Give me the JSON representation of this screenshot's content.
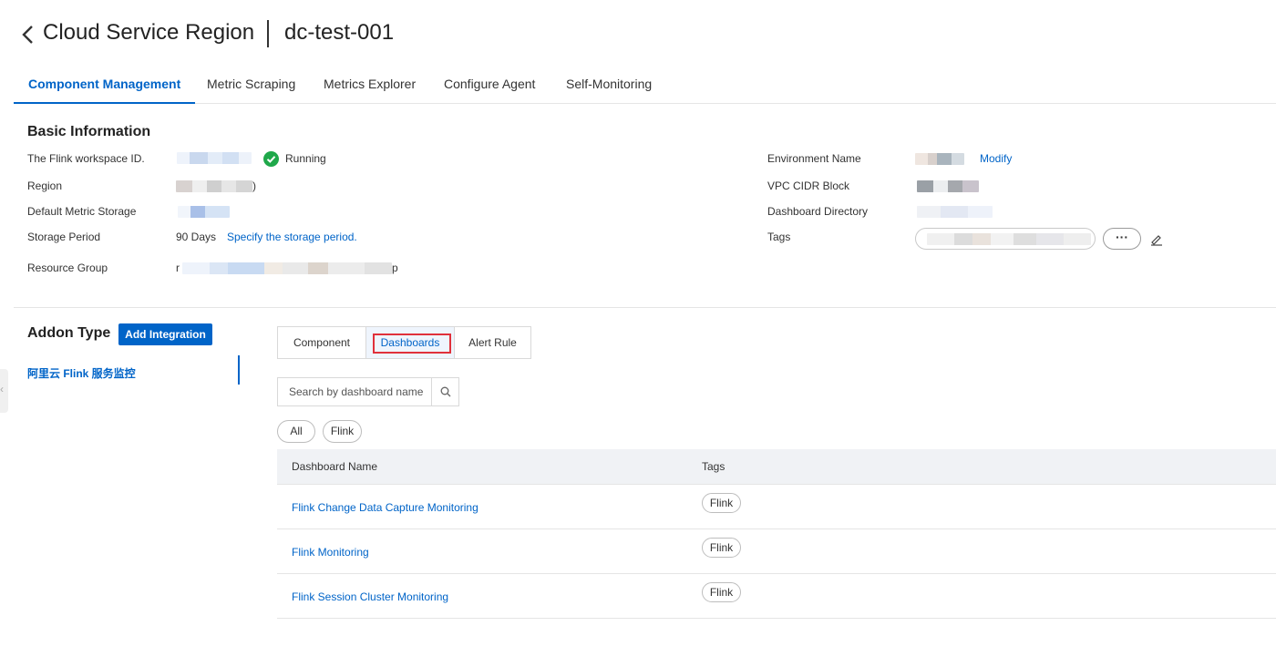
{
  "header": {
    "back_icon": "chevron-left-icon",
    "title": "Cloud Service Region",
    "subtitle": "dc-test-001"
  },
  "tabs": [
    {
      "label": "Component Management",
      "active": true
    },
    {
      "label": "Metric Scraping",
      "active": false
    },
    {
      "label": "Metrics Explorer",
      "active": false
    },
    {
      "label": "Configure Agent",
      "active": false
    },
    {
      "label": "Self-Monitoring",
      "active": false
    }
  ],
  "basic_info": {
    "title": "Basic Information",
    "workspace_label": "The Flink workspace ID.",
    "status_text": "Running",
    "status_icon": "check-circle-icon",
    "region_label": "Region",
    "region_suffix": ")",
    "storage_label": "Default Metric Storage",
    "period_label": "Storage Period",
    "period_value": "90 Days",
    "period_link": "Specify the storage period.",
    "resource_group_label": "Resource Group",
    "resource_group_prefix": "r",
    "resource_group_suffix": "p",
    "env_name_label": "Environment Name",
    "env_modify_link": "Modify",
    "vpc_label": "VPC CIDR Block",
    "dashboard_dir_label": "Dashboard Directory",
    "tags_label": "Tags",
    "more_label": "···",
    "edit_icon": "pencil-icon"
  },
  "addon": {
    "title": "Addon Type",
    "add_button": "Add Integration",
    "items": [
      "阿里云 Flink 服务监控"
    ]
  },
  "panel": {
    "segments": [
      {
        "label": "Component",
        "active": false
      },
      {
        "label": "Dashboards",
        "active": true
      },
      {
        "label": "Alert Rule",
        "active": false
      }
    ],
    "search_placeholder": "Search by dashboard name",
    "search_icon": "search-icon",
    "filters": [
      "All",
      "Flink"
    ],
    "table": {
      "columns": [
        "Dashboard Name",
        "Tags"
      ],
      "rows": [
        {
          "name": "Flink Change Data Capture Monitoring",
          "tag": "Flink"
        },
        {
          "name": "Flink Monitoring",
          "tag": "Flink"
        },
        {
          "name": "Flink Session Cluster Monitoring",
          "tag": "Flink"
        }
      ]
    }
  },
  "colors": {
    "accent": "#0064c8",
    "success": "#1fa84a",
    "highlight": "#e0313b"
  }
}
